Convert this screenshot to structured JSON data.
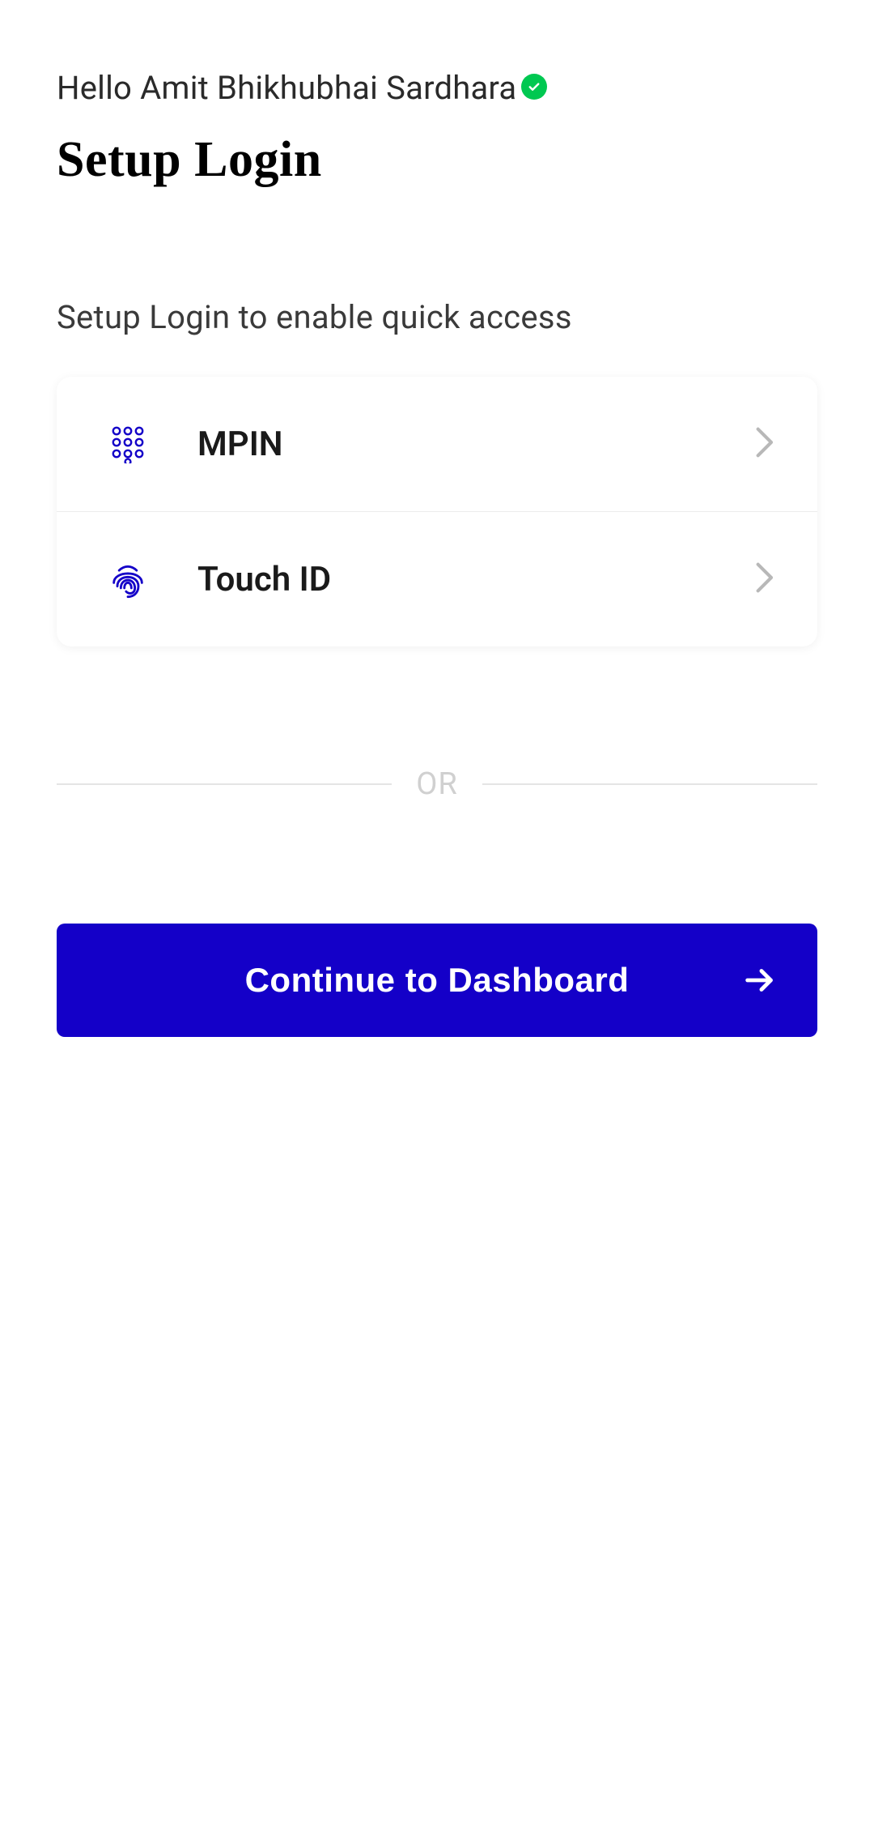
{
  "greeting": "Hello Amit Bhikhubhai Sardhara",
  "title": "Setup Login",
  "subtitle": "Setup Login to enable quick access",
  "options": {
    "mpin": {
      "label": "MPIN"
    },
    "touchid": {
      "label": "Touch ID"
    }
  },
  "separator": "OR",
  "cta": {
    "label": "Continue to Dashboard"
  },
  "colors": {
    "primary": "#1400C8",
    "verified": "#00C851"
  }
}
